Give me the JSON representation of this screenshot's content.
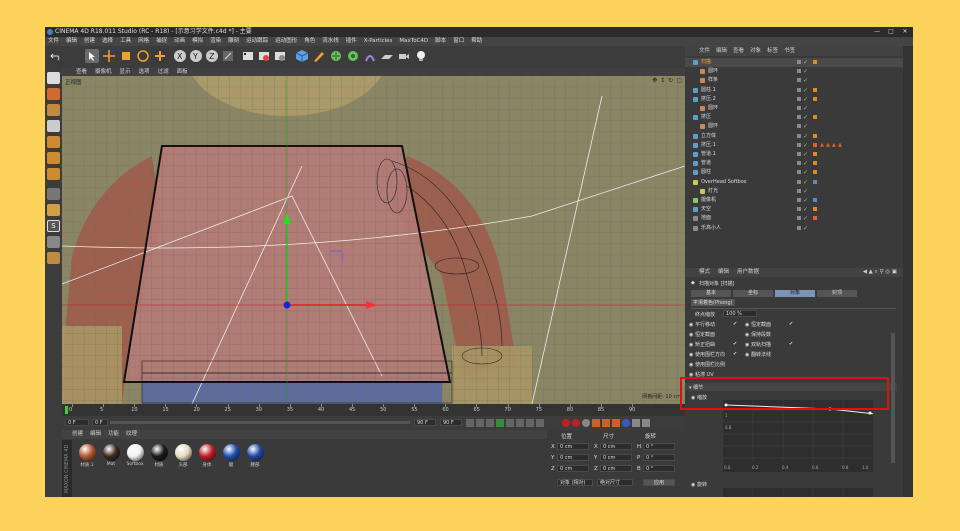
{
  "window": {
    "title": "CINEMA 4D R18.011 Studio (RC - R18) - [示意习学文件.c4d *] - 主要",
    "controls": [
      "—",
      "□",
      "✕"
    ]
  },
  "menu": [
    "文件",
    "编辑",
    "创建",
    "选择",
    "工具",
    "网格",
    "捕捉",
    "动画",
    "模拟",
    "渲染",
    "雕刻",
    "运动跟踪",
    "运动图形",
    "角色",
    "流水线",
    "插件",
    "X-Particles",
    "MaxToC4D",
    "脚本",
    "窗口",
    "帮助"
  ],
  "layout": {
    "label": "界面",
    "value": "启动"
  },
  "viewport": {
    "menu": [
      "查看",
      "摄像机",
      "显示",
      "选项",
      "过滤",
      "面板"
    ],
    "label": "正视图",
    "grid_info": "网格间距: 10 cm"
  },
  "timeline": {
    "ticks": [
      "0",
      "5",
      "10",
      "15",
      "20",
      "25",
      "30",
      "35",
      "40",
      "45",
      "50",
      "55",
      "60",
      "65",
      "70",
      "75",
      "80",
      "85",
      "90"
    ],
    "current_frame": "0 F",
    "start_field": "0 F",
    "end_field": "90 F",
    "end_field2": "90 F"
  },
  "materials": {
    "menu": [
      "创建",
      "编辑",
      "功能",
      "纹理"
    ],
    "items": [
      {
        "label": "材质.1",
        "color": "#b35a32"
      },
      {
        "label": "Mat",
        "color": "#3c2a1e"
      },
      {
        "label": "Softbox",
        "color": "#f2f2f2"
      },
      {
        "label": "材质",
        "color": "#1a1a1a"
      },
      {
        "label": "头部",
        "color": "#e8dcc0"
      },
      {
        "label": "身体",
        "color": "#c0202a"
      },
      {
        "label": "腿",
        "color": "#2050b0"
      },
      {
        "label": "腰部",
        "color": "#2048a0"
      }
    ],
    "maxon_label": "MAXON CINEMA 4D"
  },
  "coords": {
    "headers": [
      "位置",
      "尺寸",
      "旋转"
    ],
    "rows": [
      {
        "axis": "X",
        "pos": "0 cm",
        "size_axis": "X",
        "size": "0 cm",
        "rot_axis": "H",
        "rot": "0 °"
      },
      {
        "axis": "Y",
        "pos": "0 cm",
        "size_axis": "Y",
        "size": "0 cm",
        "rot_axis": "P",
        "rot": "0 °"
      },
      {
        "axis": "Z",
        "pos": "0 cm",
        "size_axis": "Z",
        "size": "0 cm",
        "rot_axis": "B",
        "rot": "0 °"
      }
    ],
    "mode": "对象 (相对)",
    "size_mode": "绝对尺寸",
    "apply": "应用"
  },
  "object_manager": {
    "menu": [
      "文件",
      "编辑",
      "查看",
      "对象",
      "标签",
      "书签"
    ],
    "objects": [
      {
        "name": "扫描",
        "indent": 0,
        "color": "#5ba0c8",
        "tag": "#e08a20"
      },
      {
        "name": "圆环",
        "indent": 1,
        "color": "#c88a5b",
        "tag": ""
      },
      {
        "name": "样条",
        "indent": 1,
        "color": "#c88a5b",
        "tag": ""
      },
      {
        "name": "圆柱.1",
        "indent": 0,
        "color": "#5ba0c8",
        "tag": "#e08a20"
      },
      {
        "name": "挤压.2",
        "indent": 0,
        "color": "#5ba0c8",
        "tag": "#e08a20"
      },
      {
        "name": "圆环",
        "indent": 1,
        "color": "#c88a5b",
        "tag": ""
      },
      {
        "name": "挤压",
        "indent": 0,
        "color": "#5ba0c8",
        "tag": "#e08a20"
      },
      {
        "name": "圆环",
        "indent": 1,
        "color": "#c88a5b",
        "tag": ""
      },
      {
        "name": "立方体",
        "indent": 0,
        "color": "#5ba0c8",
        "tag": "#e08a20"
      },
      {
        "name": "挤压.1",
        "indent": 0,
        "color": "#5ba0c8",
        "tag": "#e06020"
      },
      {
        "name": "管道.1",
        "indent": 0,
        "color": "#5ba0c8",
        "tag": "#e08a20"
      },
      {
        "name": "管道",
        "indent": 0,
        "color": "#5ba0c8",
        "tag": "#e08a20"
      },
      {
        "name": "圆柱",
        "indent": 0,
        "color": "#5ba0c8",
        "tag": "#e08a20"
      },
      {
        "name": "OverHead Softbox",
        "indent": 0,
        "color": "#c8c85b",
        "tag": "#5b8ac8"
      },
      {
        "name": "灯光",
        "indent": 1,
        "color": "#c8c85b",
        "tag": ""
      },
      {
        "name": "摄像机",
        "indent": 0,
        "color": "#8ac85b",
        "tag": "#5b8ac8"
      },
      {
        "name": "天空",
        "indent": 0,
        "color": "#5ba0c8",
        "tag": "#e08a20"
      },
      {
        "name": "地面",
        "indent": 0,
        "color": "#8a8a8a",
        "tag": "#e06040"
      },
      {
        "name": "乐高小人",
        "indent": 0,
        "color": "#8a8a8a",
        "tag": ""
      }
    ]
  },
  "attributes": {
    "menu": [
      "模式",
      "编辑",
      "用户数据"
    ],
    "object_label": "扫描对象 [扫描]",
    "tabs": [
      "基本",
      "坐标",
      "对象",
      "封顶"
    ],
    "active_tab": "对象",
    "phong_label": "平滑着色(Phong)",
    "props": {
      "end_scale_label": "终点缩放",
      "end_scale_value": "100 %",
      "left": [
        "平行移动",
        "恒定截面",
        "矫正扭曲",
        "使用围栏方向",
        "使用围栏比例"
      ],
      "right": [
        "恒定截面",
        "保持段数",
        "双轨扫描",
        "翻转法线"
      ],
      "uv_label": "粘滞 UV",
      "details_label": "细节",
      "scale_label": "缩放",
      "rotation_label": "旋转",
      "graph_ticks_x": [
        "0.0",
        "0.2",
        "0.4",
        "0.6",
        "0.8",
        "1.0"
      ],
      "graph_ticks_y": [
        "1",
        "0.8"
      ]
    }
  }
}
